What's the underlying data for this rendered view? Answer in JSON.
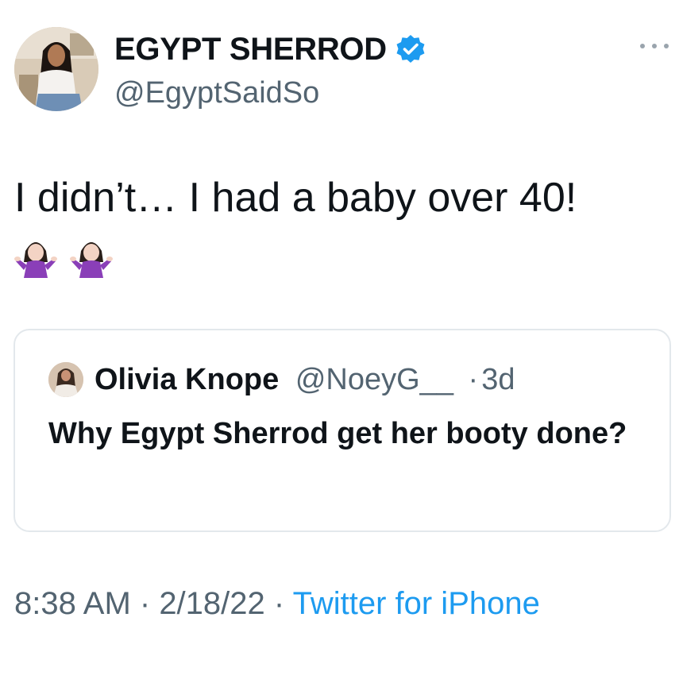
{
  "author": {
    "display_name": "EGYPT SHERROD",
    "handle": "@EgyptSaidSo",
    "verified": true,
    "avatar": "profile-photo"
  },
  "header": {
    "more_icon": "ellipsis-icon"
  },
  "tweet": {
    "text": "I didn’t… I had a baby over 40!",
    "emojis": [
      "woman-shrugging",
      "woman-shrugging"
    ]
  },
  "quoted_tweet": {
    "display_name": "Olivia Knope",
    "handle": "@NoeyG__",
    "separator": "·",
    "time": "3d",
    "text": "Why Egypt Sherrod get her booty done?"
  },
  "meta": {
    "time": "8:38 AM",
    "sep1": " · ",
    "date": "2/18/22",
    "sep2": " · ",
    "source": "Twitter for iPhone"
  },
  "colors": {
    "verified_badge": "#1d9bf0",
    "secondary_text": "#536471",
    "link": "#1d9bf0",
    "border": "#e3e8ec"
  }
}
